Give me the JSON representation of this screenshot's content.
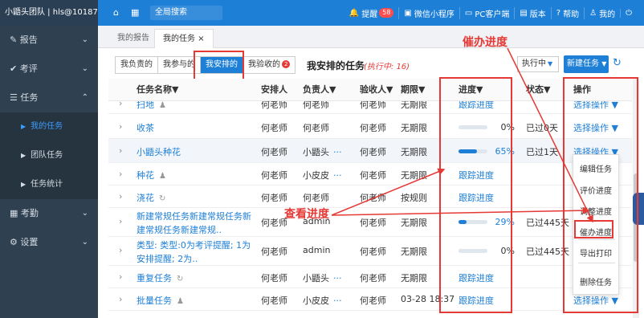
{
  "topbar": {
    "team": "小鼯头团队 | hls@10187",
    "home_icon": "home-icon",
    "grid_icon": "grid-icon",
    "search_label": "全局搜索",
    "items": [
      {
        "icon": "bell-icon",
        "label": "提醒",
        "badge": "58"
      },
      {
        "icon": "wechat-icon",
        "label": "微信小程序"
      },
      {
        "icon": "desktop-icon",
        "label": "PC客户端"
      },
      {
        "icon": "version-icon",
        "label": "版本"
      },
      {
        "icon": "help-icon",
        "label": "帮助"
      },
      {
        "icon": "user-icon",
        "label": "我的"
      },
      {
        "icon": "power-icon",
        "label": ""
      }
    ]
  },
  "sidebar": {
    "items": [
      {
        "icon": "edit-icon",
        "label": "报告",
        "chev": "⌄"
      },
      {
        "icon": "check-icon",
        "label": "考评",
        "chev": "⌄"
      },
      {
        "icon": "list-icon",
        "label": "任务",
        "chev": "⌃"
      },
      {
        "label": "我的任务"
      },
      {
        "label": "团队任务"
      },
      {
        "label": "任务统计"
      },
      {
        "icon": "calendar-icon",
        "label": "考勤",
        "chev": "⌄"
      },
      {
        "icon": "gear-icon",
        "label": "设置",
        "chev": "⌄"
      }
    ]
  },
  "page_tabs": [
    {
      "label": "我的报告"
    },
    {
      "label": "我的任务",
      "close": "×"
    }
  ],
  "sub_tabs": [
    {
      "label": "我负责的"
    },
    {
      "label": "我参与的"
    },
    {
      "label": "我安排的"
    },
    {
      "label": "我验收的",
      "badge": "2"
    }
  ],
  "page_title": "我安排的任务",
  "page_subtitle": "(执行中: 16)",
  "status_filter": "执行中",
  "new_task_label": "新建任务",
  "columns": {
    "name": "任务名称▼",
    "arranger": "安排人",
    "owner": "负责人▼",
    "checker": "验收人▼",
    "deadline": "期限▼",
    "progress": "进度▼",
    "status": "状态▼",
    "ops": "操作"
  },
  "rows": [
    {
      "name": "扫地",
      "arranger": "何老师",
      "owner": "何老师",
      "checker": "何老师",
      "deadline": "无期限",
      "progress_link": "跟踪进度",
      "status": "",
      "op": "选择操作 ▼"
    },
    {
      "name": "收茶",
      "arranger": "何老师",
      "owner": "何老师",
      "checker": "何老师",
      "deadline": "无期限",
      "progress_pct": "0%",
      "progress_value": 0,
      "status": "已过0天",
      "op": "选择操作 ▼"
    },
    {
      "name": "小鼯头种花",
      "arranger": "何老师",
      "owner": "小鼯头",
      "checker": "何老师",
      "deadline": "无期限",
      "progress_pct": "65%",
      "progress_value": 65,
      "status": "已过1天",
      "op": "选择操作 ▼"
    },
    {
      "name": "种花",
      "arranger": "何老师",
      "owner": "小皮皮",
      "checker": "何老师",
      "deadline": "无期限",
      "progress_link": "跟踪进度",
      "status": "",
      "op": ""
    },
    {
      "name": "浇花",
      "arranger": "何老师",
      "owner": "何老师",
      "checker": "何老师",
      "deadline": "按规则",
      "progress_link": "跟踪进度",
      "status": "",
      "op": ""
    },
    {
      "name": "新建常规任务新建常规任务新建常规任务新建常规..",
      "arranger": "何老师",
      "owner": "admin",
      "checker": "何老师",
      "deadline": "无期限",
      "progress_pct": "29%",
      "progress_value": 29,
      "status": "已过445天",
      "op": ""
    },
    {
      "name": "类型: 类型:0为考评提醒; 1为安排提醒; 2为..",
      "arranger": "何老师",
      "owner": "admin",
      "checker": "何老师",
      "deadline": "无期限",
      "progress_pct": "0%",
      "progress_value": 0,
      "status": "已过445天",
      "op": ""
    },
    {
      "name": "重复任务",
      "arranger": "何老师",
      "owner": "小鼯头",
      "checker": "何老师",
      "deadline": "无期限",
      "progress_link": "跟踪进度",
      "status": "",
      "op": ""
    },
    {
      "name": "批量任务",
      "arranger": "何老师",
      "owner": "小皮皮",
      "checker": "何老师",
      "deadline": "03-28 18:37",
      "progress_link": "跟踪进度",
      "status": "",
      "op": "选择操作 ▼"
    }
  ],
  "dropdown": [
    "编辑任务",
    "评价进度",
    "调整进度",
    "催办进度",
    "导出打印",
    "删除任务"
  ],
  "callouts": {
    "urge": "催办进度",
    "view": "查看进度"
  },
  "accent": "#1e7fd7",
  "annotation_color": "#e53935"
}
